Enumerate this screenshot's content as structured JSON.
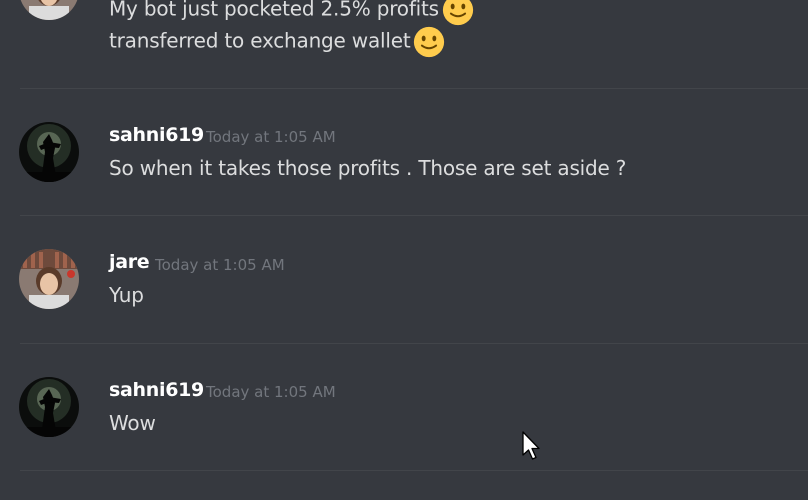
{
  "messages": [
    {
      "username": "",
      "timestamp": "",
      "lines": [
        {
          "text": "My bot just pocketed 2.5% profits",
          "emoji": "slightly-smiling-face-emoji"
        },
        {
          "text": "transferred to exchange wallet",
          "emoji": "slightly-smiling-face-emoji"
        }
      ]
    },
    {
      "username": "sahni619",
      "timestamp": "Today at 1:05 AM",
      "lines": [
        {
          "text": "So when it takes those profits . Those are set aside ?"
        }
      ]
    },
    {
      "username": "jare",
      "timestamp": "Today at 1:05 AM",
      "lines": [
        {
          "text": "Yup"
        }
      ]
    },
    {
      "username": "sahni619",
      "timestamp": "Today at 1:05 AM",
      "lines": [
        {
          "text": "Wow"
        }
      ]
    }
  ],
  "colors": {
    "background": "#36393f",
    "username": "#ffffff",
    "timestamp": "#72767d",
    "message_text": "#dcddde",
    "divider": "#42454a",
    "emoji": "#ffcc4d"
  },
  "icons": {
    "emoji": "slightly-smiling-face-emoji",
    "cursor": "mouse-pointer-icon"
  }
}
